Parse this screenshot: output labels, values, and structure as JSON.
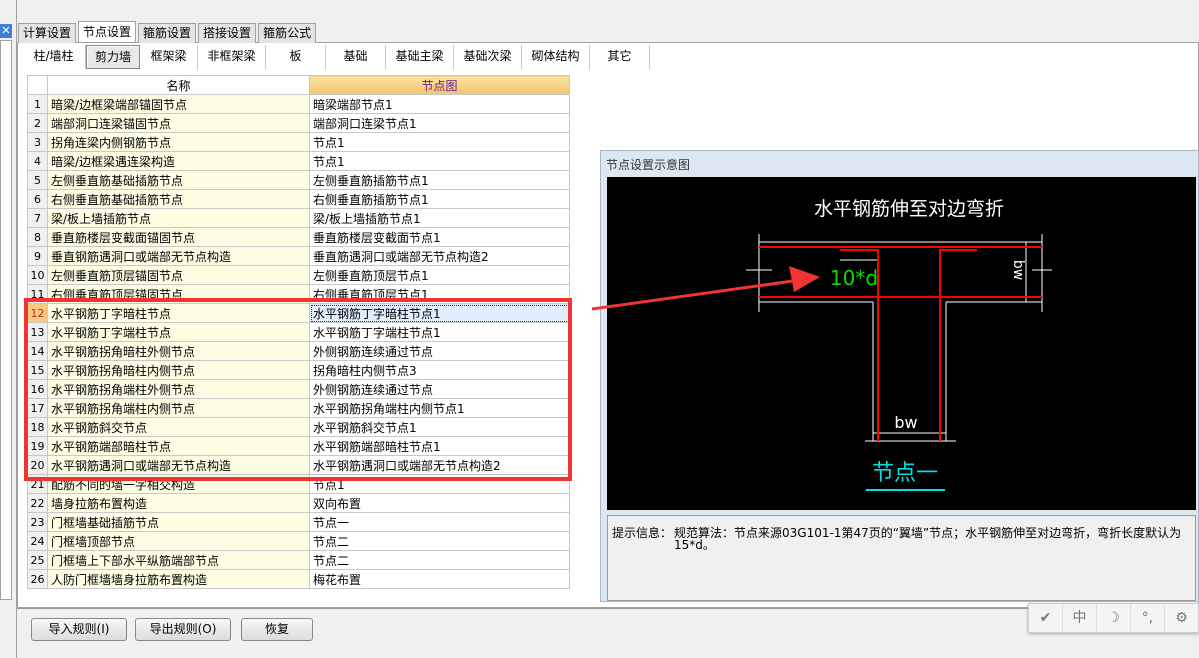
{
  "top_tabs": [
    "计算设置",
    "节点设置",
    "箍筋设置",
    "搭接设置",
    "箍筋公式"
  ],
  "active_top_tab": 1,
  "sub_tabs": [
    "柱/墙柱",
    "剪力墙",
    "框架梁",
    "非框架梁",
    "板",
    "基础",
    "基础主梁",
    "基础次梁",
    "砌体结构",
    "其它"
  ],
  "active_sub_tab": 1,
  "table": {
    "headers": {
      "name": "名称",
      "node": "节点图"
    },
    "selected_row": 12,
    "rows": [
      {
        "no": "1",
        "name": "暗梁/边框梁端部锚固节点",
        "node": "暗梁端部节点1"
      },
      {
        "no": "2",
        "name": "端部洞口连梁锚固节点",
        "node": "端部洞口连梁节点1"
      },
      {
        "no": "3",
        "name": "拐角连梁内侧钢筋节点",
        "node": "节点1"
      },
      {
        "no": "4",
        "name": "暗梁/边框梁遇连梁构造",
        "node": "节点1"
      },
      {
        "no": "5",
        "name": "左侧垂直筋基础插筋节点",
        "node": "左侧垂直筋插筋节点1"
      },
      {
        "no": "6",
        "name": "右侧垂直筋基础插筋节点",
        "node": "右侧垂直筋插筋节点1"
      },
      {
        "no": "7",
        "name": "梁/板上墙插筋节点",
        "node": "梁/板上墙插筋节点1"
      },
      {
        "no": "8",
        "name": "垂直筋楼层变截面锚固节点",
        "node": "垂直筋楼层变截面节点1"
      },
      {
        "no": "9",
        "name": "垂直钢筋遇洞口或端部无节点构造",
        "node": "垂直筋遇洞口或端部无节点构造2"
      },
      {
        "no": "10",
        "name": "左侧垂直筋顶层锚固节点",
        "node": "左侧垂直筋顶层节点1"
      },
      {
        "no": "11",
        "name": "右侧垂直筋顶层锚固节点",
        "node": "右侧垂直筋顶层节点1"
      },
      {
        "no": "12",
        "name": "水平钢筋丁字暗柱节点",
        "node": "水平钢筋丁字暗柱节点1"
      },
      {
        "no": "13",
        "name": "水平钢筋丁字端柱节点",
        "node": "水平钢筋丁字端柱节点1"
      },
      {
        "no": "14",
        "name": "水平钢筋拐角暗柱外侧节点",
        "node": "外侧钢筋连续通过节点"
      },
      {
        "no": "15",
        "name": "水平钢筋拐角暗柱内侧节点",
        "node": "拐角暗柱内侧节点3"
      },
      {
        "no": "16",
        "name": "水平钢筋拐角端柱外侧节点",
        "node": "外侧钢筋连续通过节点"
      },
      {
        "no": "17",
        "name": "水平钢筋拐角端柱内侧节点",
        "node": "水平钢筋拐角端柱内侧节点1"
      },
      {
        "no": "18",
        "name": "水平钢筋斜交节点",
        "node": "水平钢筋斜交节点1"
      },
      {
        "no": "19",
        "name": "水平钢筋端部暗柱节点",
        "node": "水平钢筋端部暗柱节点1"
      },
      {
        "no": "20",
        "name": "水平钢筋遇洞口或端部无节点构造",
        "node": "水平钢筋遇洞口或端部无节点构造2"
      },
      {
        "no": "21",
        "name": "配筋不同的墙一字相交构造",
        "node": "节点1"
      },
      {
        "no": "22",
        "name": "墙身拉筋布置构造",
        "node": "双向布置"
      },
      {
        "no": "23",
        "name": "门框墙基础插筋节点",
        "node": "节点一"
      },
      {
        "no": "24",
        "name": "门框墙顶部节点",
        "node": "节点二"
      },
      {
        "no": "25",
        "name": "门框墙上下部水平纵筋端部节点",
        "node": "节点二"
      },
      {
        "no": "26",
        "name": "人防门框墙墙身拉筋布置构造",
        "node": "梅花布置"
      }
    ]
  },
  "diagram": {
    "panel_title": "节点设置示意图",
    "heading": "水平钢筋伸至对边弯折",
    "dim_label": "10*d",
    "bw_label": "bw",
    "node_label": "节点一",
    "colors": {
      "rebar": "#ff0000",
      "dim_text": "#00e000",
      "node_label": "#00e0e0",
      "outline": "#ffffff"
    }
  },
  "hint": {
    "label": "提示信息：",
    "text": "规范算法：节点来源03G101-1第47页的“翼墙”节点；水平钢筋伸至对边弯折，弯折长度默认为15*d。"
  },
  "buttons": {
    "import": "导入规则(I)",
    "export": "导出规则(O)",
    "restore": "恢复"
  },
  "ime": [
    "✔",
    "中",
    "☽",
    "°,",
    "⚙"
  ],
  "annotation_color": "#f03434"
}
